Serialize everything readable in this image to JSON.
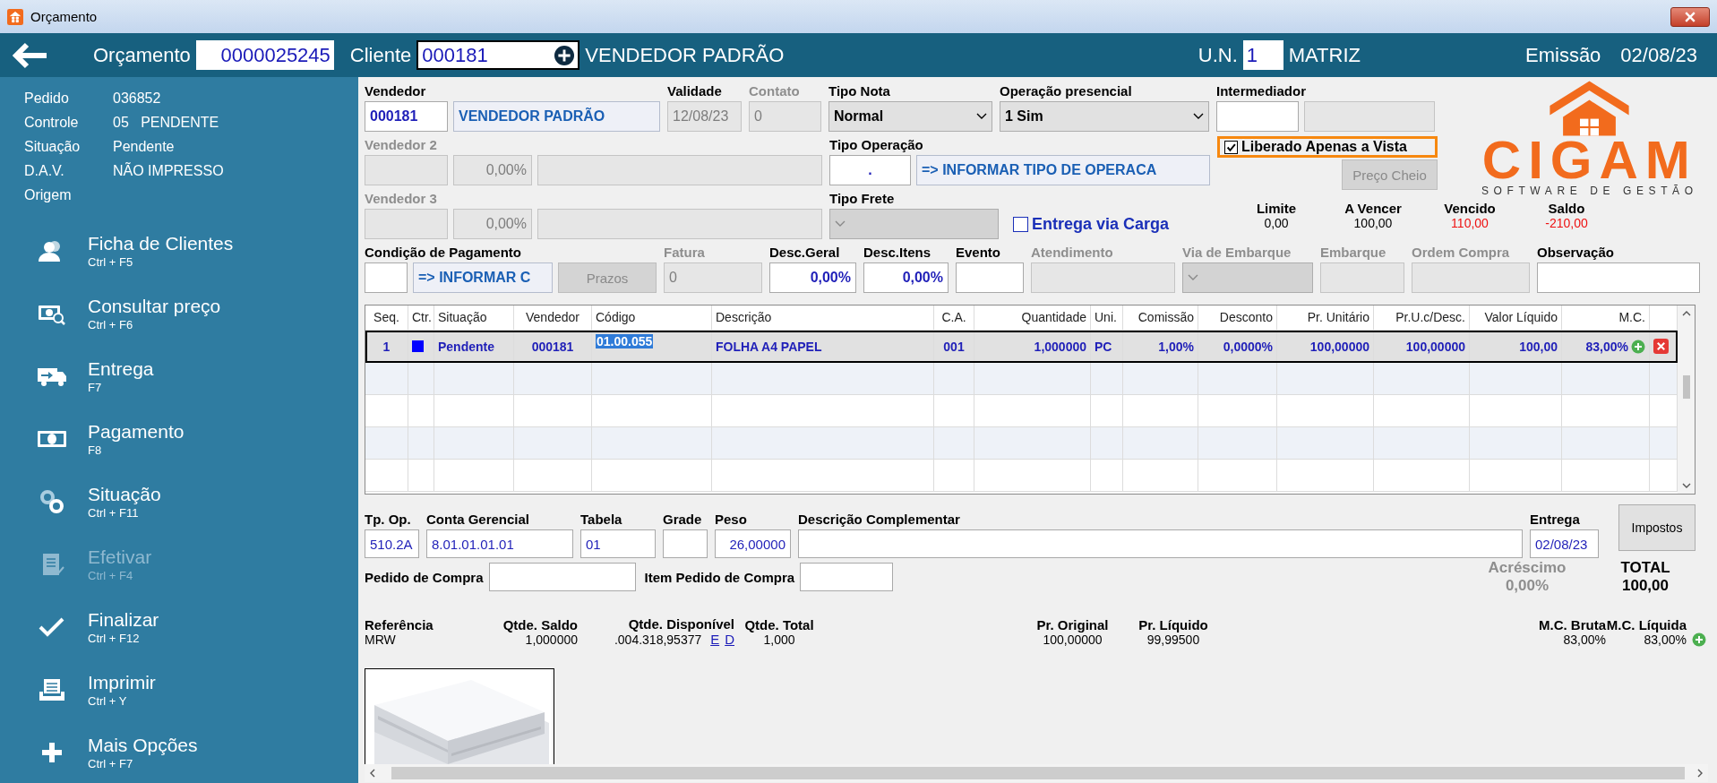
{
  "window": {
    "title": "Orçamento"
  },
  "header": {
    "orcamento_label": "Orçamento",
    "orcamento": "0000025245",
    "cliente_label": "Cliente",
    "cliente_code": "000181",
    "cliente_name": "VENDEDOR PADRÃO",
    "un_label": "U.N.",
    "un": "1",
    "un_name": "MATRIZ",
    "emissao_label": "Emissão",
    "emissao": "02/08/23"
  },
  "summary": [
    {
      "label": "Pedido",
      "value": "036852"
    },
    {
      "label": "Controle",
      "value": "05   PENDENTE"
    },
    {
      "label": "Situação",
      "value": "Pendente"
    },
    {
      "label": "D.A.V.",
      "value": "NÃO IMPRESSO"
    },
    {
      "label": "Origem"
    }
  ],
  "actions": [
    {
      "kind": "clients",
      "label": "Ficha de Clientes",
      "shortcut": "Ctrl + F5",
      "disabled": false
    },
    {
      "kind": "price",
      "label": "Consultar preço",
      "shortcut": "Ctrl + F6",
      "disabled": false
    },
    {
      "kind": "delivery",
      "label": "Entrega",
      "shortcut": "F7",
      "disabled": false
    },
    {
      "kind": "payment",
      "label": "Pagamento",
      "shortcut": "F8",
      "disabled": false
    },
    {
      "kind": "status",
      "label": "Situação",
      "shortcut": "Ctrl + F11",
      "disabled": false
    },
    {
      "kind": "confirm",
      "label": "Efetivar",
      "shortcut": "Ctrl + F4",
      "disabled": true
    },
    {
      "kind": "finish",
      "label": "Finalizar",
      "shortcut": "Ctrl + F12",
      "disabled": false
    },
    {
      "kind": "print",
      "label": "Imprimir",
      "shortcut": "Ctrl + Y",
      "disabled": false
    },
    {
      "kind": "more",
      "label": "Mais Opções",
      "shortcut": "Ctrl + F7",
      "disabled": false
    }
  ],
  "form_rows": [
    [
      {
        "label": "Vendedor",
        "disabled": false,
        "controls": [
          {
            "kind": "code",
            "value": "000181"
          },
          {
            "kind": "lookup",
            "value": "VENDEDOR PADRÃO"
          }
        ]
      },
      {
        "label": "Validade",
        "disabled": false,
        "controls": [
          {
            "kind": "readonly",
            "value": "12/08/23"
          }
        ]
      },
      {
        "label": "Contato",
        "disabled": true,
        "controls": [
          {
            "kind": "readonly",
            "value": "0"
          }
        ]
      },
      {
        "label": "Tipo Nota",
        "disabled": false,
        "controls": [
          {
            "kind": "select",
            "value": "Normal"
          }
        ]
      },
      {
        "label": "Operação presencial",
        "disabled": false,
        "controls": [
          {
            "kind": "select",
            "value": "1 Sim"
          }
        ]
      },
      {
        "label": "Intermediador",
        "disabled": false,
        "controls": [
          {
            "kind": "input"
          },
          {
            "kind": "readonly"
          }
        ]
      }
    ],
    [
      {
        "label": "Vendedor 2",
        "disabled": true,
        "controls": [
          {
            "kind": "readonly"
          },
          {
            "kind": "readonly-number",
            "value": "0,00%"
          },
          {
            "kind": "readonly"
          }
        ]
      },
      {
        "label": "Tipo Operação",
        "disabled": false,
        "controls": [
          {
            "kind": "number-center",
            "value": "."
          },
          {
            "kind": "lookup",
            "value": "=> INFORMAR TIPO DE OPERACA"
          }
        ]
      },
      {
        "checkbox": {
          "label": "Liberado Apenas a Vista",
          "checked": true,
          "highlighted": true
        },
        "controls": [
          {
            "kind": "button",
            "value": "Preço Cheio"
          }
        ]
      }
    ],
    [
      {
        "label": "Vendedor 3",
        "disabled": true,
        "controls": [
          {
            "kind": "readonly"
          },
          {
            "kind": "readonly-number",
            "value": "0,00%"
          },
          {
            "kind": "readonly"
          }
        ]
      },
      {
        "label": "Tipo Frete",
        "disabled": false,
        "controls": [
          {
            "kind": "select-disabled"
          }
        ]
      },
      {
        "controls": [
          {
            "kind": "checkbox",
            "value": "Entrega via Carga",
            "checked": false
          }
        ]
      }
    ],
    [
      {
        "label": "Condição de Pagamento",
        "disabled": false,
        "controls": [
          {
            "kind": "input"
          },
          {
            "kind": "lookup",
            "value": "=> INFORMAR C"
          },
          {
            "kind": "button",
            "value": "Prazos"
          }
        ]
      },
      {
        "label": "Fatura",
        "disabled": true,
        "controls": [
          {
            "kind": "readonly",
            "value": "0"
          }
        ]
      },
      {
        "label": "Desc.Geral",
        "disabled": false,
        "controls": [
          {
            "kind": "number",
            "value": "0,00%"
          }
        ]
      },
      {
        "label": "Desc.Itens",
        "disabled": false,
        "controls": [
          {
            "kind": "number",
            "value": "0,00%"
          }
        ]
      },
      {
        "label": "Evento",
        "disabled": false,
        "controls": [
          {
            "kind": "input"
          }
        ]
      },
      {
        "label": "Atendimento",
        "disabled": true,
        "controls": [
          {
            "kind": "readonly"
          }
        ]
      },
      {
        "label": "Via de Embarque",
        "disabled": true,
        "controls": [
          {
            "kind": "select-disabled"
          }
        ]
      },
      {
        "label": "Embarque",
        "disabled": true,
        "controls": [
          {
            "kind": "readonly"
          }
        ]
      },
      {
        "label": "Ordem Compra",
        "disabled": true,
        "controls": [
          {
            "kind": "readonly"
          }
        ]
      },
      {
        "label": "Observação",
        "disabled": false,
        "controls": [
          {
            "kind": "input"
          }
        ]
      }
    ]
  ],
  "credit": [
    {
      "label": "Limite",
      "value": "0,00",
      "alert": false
    },
    {
      "label": "A Vencer",
      "value": "100,00",
      "alert": false
    },
    {
      "label": "Vencido",
      "value": "110,00",
      "alert": true
    },
    {
      "label": "Saldo",
      "value": "-210,00",
      "alert": true
    }
  ],
  "logo": {
    "name": "CIGAM",
    "tagline": "SOFTWARE DE GESTÃO"
  },
  "table": {
    "columns": [
      "Seq.",
      "Ctr.",
      "Situação",
      "Vendedor",
      "Código",
      "Descrição",
      "C.A.",
      "Quantidade",
      "Uni.",
      "Comissão",
      "Desconto",
      "Pr. Unitário",
      "Pr.U.c/Desc.",
      "Valor Líquido",
      "M.C."
    ],
    "rows": [
      {
        "selected": true,
        "color": "#0000ff",
        "cells": [
          "1",
          "",
          "Pendente",
          "000181",
          "01.00.055",
          "FOLHA A4 PAPEL",
          "001",
          "1,000000",
          "PC",
          "1,00%",
          "0,0000%",
          "100,00000",
          "100,00000",
          "100,00",
          "83,00%"
        ]
      }
    ]
  },
  "bottom_fields": [
    {
      "label": "Tp. Op.",
      "kind": "input",
      "value": "510.2A"
    },
    {
      "label": "Conta Gerencial",
      "kind": "input",
      "value": "8.01.01.01.01"
    },
    {
      "label": "Tabela",
      "kind": "input",
      "value": "01"
    },
    {
      "label": "Grade",
      "kind": "input"
    },
    {
      "label": "Peso",
      "kind": "number",
      "value": "26,00000"
    },
    {
      "label": "Descrição Complementar",
      "kind": "input"
    },
    {
      "label": "Entrega",
      "kind": "input",
      "value": "02/08/23"
    }
  ],
  "taxes_button": "Impostos",
  "purchase_fields": [
    {
      "label": "Pedido de Compra"
    },
    {
      "label": "Item Pedido de Compra"
    }
  ],
  "surcharge": {
    "label": "Acréscimo",
    "value": "0,00%"
  },
  "total": {
    "label": "TOTAL",
    "value": "100,00"
  },
  "reference": [
    {
      "label": "Referência",
      "value": "MRW"
    },
    {
      "label": "Qtde. Saldo",
      "value": "1,000000"
    },
    {
      "label": "Qtde. Disponível",
      "value": ".004.318,95377",
      "links": [
        "E",
        "D"
      ]
    },
    {
      "label": "Qtde. Total",
      "value": "1,000"
    },
    {
      "label": "Pr. Original",
      "value": "100,00000"
    },
    {
      "label": "Pr. Líquido",
      "value": "99,99500"
    },
    {
      "label": "M.C. Bruta",
      "value": "83,00%"
    },
    {
      "label": "M.C. Líquida",
      "value": "83,00%"
    }
  ],
  "product_image": {
    "kind": "picture"
  }
}
